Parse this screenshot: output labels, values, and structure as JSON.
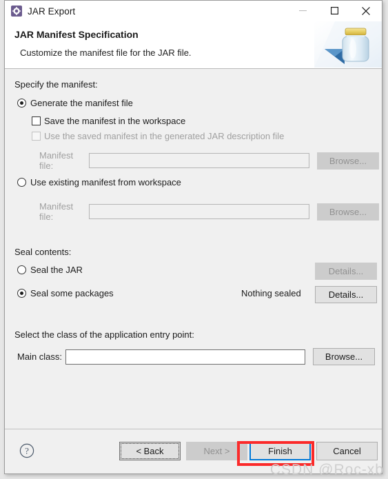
{
  "window": {
    "title": "JAR Export",
    "icon": "gear-icon",
    "controls": {
      "minimize": "minimize-icon",
      "maximize": "maximize-icon",
      "close": "close-icon"
    }
  },
  "header": {
    "title": "JAR Manifest Specification",
    "description": "Customize the manifest file for the JAR file.",
    "banner_icon": "jar-banner-icon"
  },
  "manifest": {
    "section_label": "Specify the manifest:",
    "generate_option": "Generate the manifest file",
    "save_in_workspace": "Save the manifest in the workspace",
    "use_saved_manifest": "Use the saved manifest in the generated JAR description file",
    "manifest_file_label_1": "Manifest file:",
    "manifest_file_value_1": "",
    "browse_1": "Browse...",
    "use_existing_option": "Use existing manifest from workspace",
    "manifest_file_label_2": "Manifest file:",
    "manifest_file_value_2": "",
    "browse_2": "Browse..."
  },
  "seal": {
    "section_label": "Seal contents:",
    "seal_jar_option": "Seal the JAR",
    "seal_jar_details": "Details...",
    "seal_packages_option": "Seal some packages",
    "seal_packages_status": "Nothing sealed",
    "seal_packages_details": "Details..."
  },
  "entry_point": {
    "section_label": "Select the class of the application entry point:",
    "main_class_label": "Main class:",
    "main_class_value": "",
    "browse": "Browse..."
  },
  "buttons": {
    "help": "help-icon",
    "back": "< Back",
    "next": "Next >",
    "finish": "Finish",
    "cancel": "Cancel"
  },
  "annotation": {
    "color": "#fb2a2a",
    "focus_color": "#0078d7"
  },
  "watermark": {
    "text": "CSDN @Roc-xb"
  }
}
